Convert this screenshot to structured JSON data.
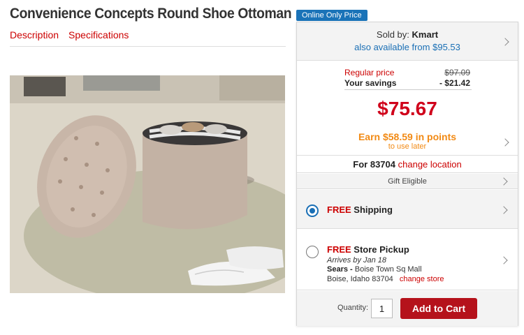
{
  "product": {
    "title": "Convenience Concepts Round Shoe Ottoman",
    "tabs": [
      "Description",
      "Specifications"
    ]
  },
  "badge": "Online Only Price",
  "seller": {
    "sold_by_label": "Sold by:",
    "sold_by_name": "Kmart",
    "also_available": "also available from $95.53"
  },
  "pricing": {
    "regular_label": "Regular price",
    "regular_value": "$97.09",
    "savings_label": "Your savings",
    "savings_value": "- $21.42",
    "price": "$75.67",
    "points": "Earn $58.59 in points",
    "points_sub": "to use later"
  },
  "location": {
    "prefix": "For 83704",
    "change_link": "change location"
  },
  "gift": "Gift Eligible",
  "shipping": {
    "free": "FREE",
    "label": "Shipping",
    "selected": true
  },
  "pickup": {
    "free": "FREE",
    "label": "Store Pickup",
    "arrives": "Arrives by Jan 18",
    "store_name": "Sears -",
    "store_location": "Boise Town Sq Mall",
    "address": "Boise, Idaho 83704",
    "change_store": "change store",
    "selected": false
  },
  "cart": {
    "quantity_label": "Quantity:",
    "quantity_value": "1",
    "add_button": "Add to Cart"
  },
  "colors": {
    "accent_red": "#cc0000",
    "price_red": "#d0021b",
    "link_blue": "#1a6fb5",
    "points_orange": "#f28a14",
    "badge_blue": "#1a73b8",
    "cart_button": "#b5121b"
  }
}
